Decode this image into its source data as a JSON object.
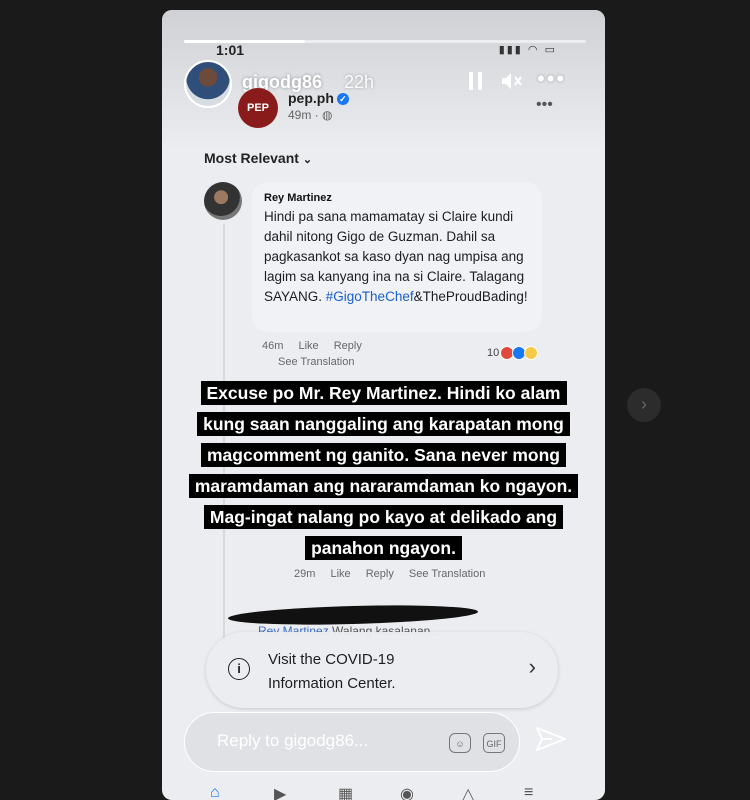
{
  "story": {
    "username": "gigodg86",
    "age": "22h",
    "progress": 0.3,
    "status_time": "1:01",
    "pause_icon": "pause-icon",
    "mute_icon": "mute-icon",
    "more_icon": "more-icon"
  },
  "post": {
    "page_name": "pep.ph",
    "avatar_text": "PEP",
    "time": "49m",
    "sort_label": "Most Relevant"
  },
  "comment": {
    "author": "Rey Martinez",
    "body": "Hindi pa sana mamamatay si Claire kundi dahil nitong Gigo de Guzman. Dahil sa pagkasankot sa kaso dyan nag umpisa ang lagim sa kanyang ina na si Claire. Talagang SAYANG.",
    "hashtag": "#GigoTheChef",
    "tail": "&TheProudBading!",
    "time": "46m",
    "like": "Like",
    "reply": "Reply",
    "see_translation": "See Translation",
    "reaction_count": "10"
  },
  "reply_meta": {
    "time": "29m",
    "like": "Like",
    "reply": "Reply",
    "see_translation": "See Translation"
  },
  "overlay_text": "Excuse po Mr. Rey Martinez. Hindi ko alam kung saan nanggaling ang karapatan mong magcomment ng ganito. Sana never mong maramdaman ang nararamdaman ko ngayon. Mag-ingat nalang po kayo at delikado ang panahon ngayon.",
  "second_reply": {
    "mention": "Rey Martinez",
    "text": "Walang kasalanan..."
  },
  "covid": {
    "line1": "Visit the COVID-19",
    "line2": "Information Center."
  },
  "reply_box": {
    "placeholder": "Reply to gigodg86..."
  },
  "colors": {
    "overlay_bg": "#000000",
    "facebook_blue": "#1877f2"
  }
}
